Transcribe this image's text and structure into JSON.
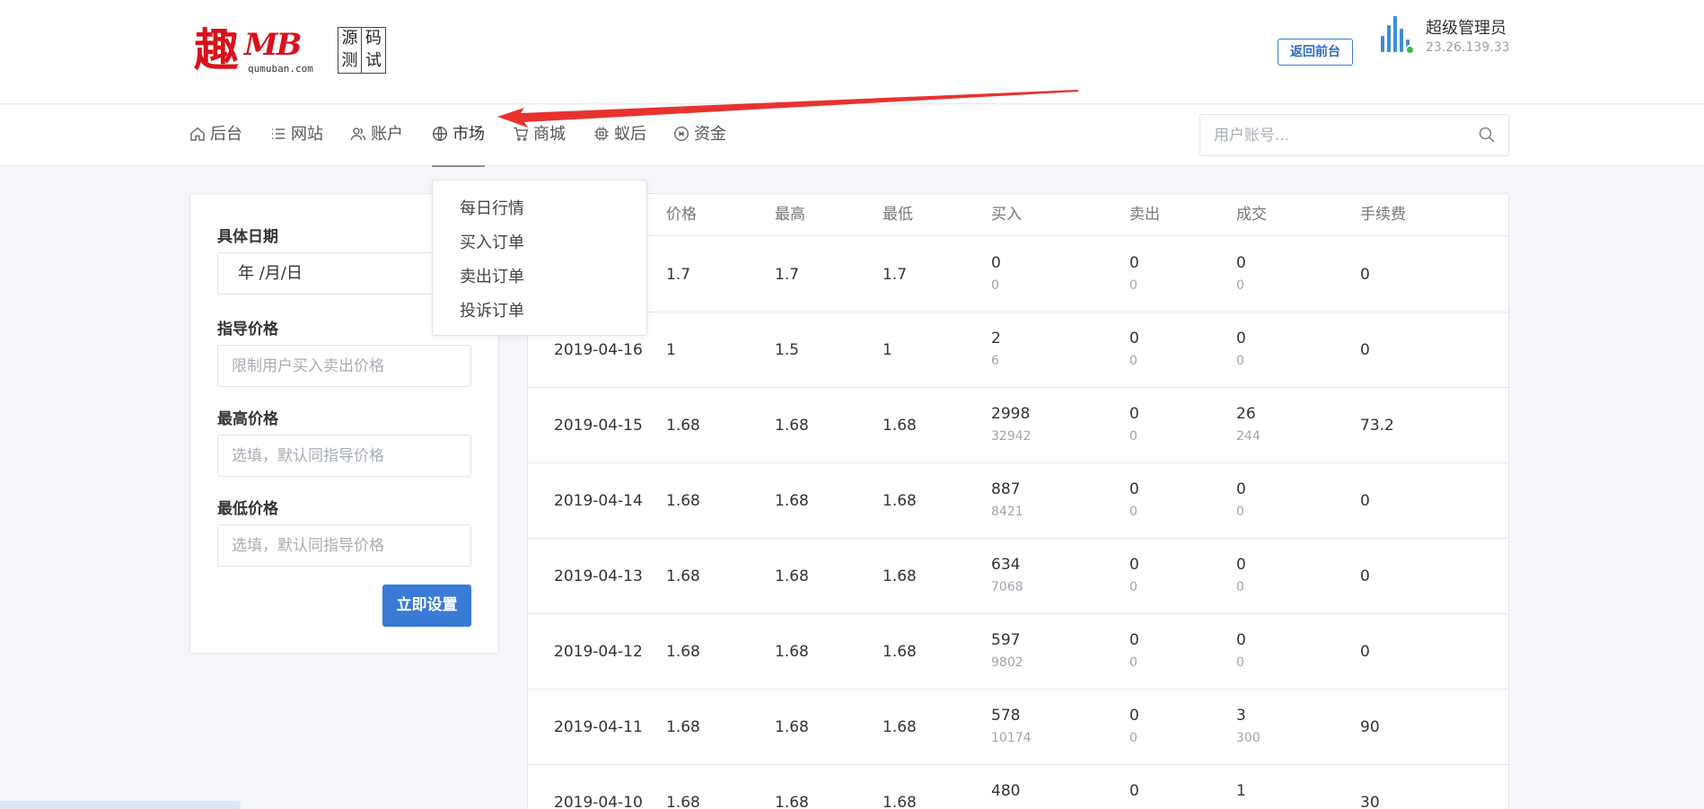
{
  "logo": {
    "char": "趣",
    "mb": "MB",
    "site": "qumuban.com",
    "stamp": [
      "源",
      "码",
      "测",
      "试"
    ]
  },
  "header": {
    "back_button": "返回前台",
    "admin_name": "超级管理员",
    "admin_ip": "23.26.139.33"
  },
  "nav": {
    "items": [
      {
        "label": "后台",
        "icon": "home-icon"
      },
      {
        "label": "网站",
        "icon": "list-icon"
      },
      {
        "label": "账户",
        "icon": "users-icon"
      },
      {
        "label": "市场",
        "icon": "globe-icon",
        "active": true
      },
      {
        "label": "商城",
        "icon": "cart-icon"
      },
      {
        "label": "蚁后",
        "icon": "chip-icon"
      },
      {
        "label": "资金",
        "icon": "coin-icon"
      }
    ],
    "search_placeholder": "用户账号..."
  },
  "dropdown": {
    "items": [
      "每日行情",
      "买入订单",
      "卖出订单",
      "投诉订单"
    ]
  },
  "form": {
    "date_label": "具体日期",
    "date_value": "年 /月/日",
    "guide_label": "指导价格",
    "guide_placeholder": "限制用户买入卖出价格",
    "max_label": "最高价格",
    "max_placeholder": "选填，默认同指导价格",
    "min_label": "最低价格",
    "min_placeholder": "选填，默认同指导价格",
    "submit": "立即设置"
  },
  "table": {
    "headers": [
      "价格",
      "最高",
      "最低",
      "买入",
      "卖出",
      "成交",
      "手续费"
    ],
    "rows": [
      {
        "date": "",
        "price": "1.7",
        "high": "1.7",
        "low": "1.7",
        "buy": "0",
        "buy_sub": "0",
        "sell": "0",
        "sell_sub": "0",
        "deal": "0",
        "deal_sub": "0",
        "fee": "0"
      },
      {
        "date": "2019-04-16",
        "price": "1",
        "high": "1.5",
        "low": "1",
        "buy": "2",
        "buy_sub": "6",
        "sell": "0",
        "sell_sub": "0",
        "deal": "0",
        "deal_sub": "0",
        "fee": "0"
      },
      {
        "date": "2019-04-15",
        "price": "1.68",
        "high": "1.68",
        "low": "1.68",
        "buy": "2998",
        "buy_sub": "32942",
        "sell": "0",
        "sell_sub": "0",
        "deal": "26",
        "deal_sub": "244",
        "fee": "73.2"
      },
      {
        "date": "2019-04-14",
        "price": "1.68",
        "high": "1.68",
        "low": "1.68",
        "buy": "887",
        "buy_sub": "8421",
        "sell": "0",
        "sell_sub": "0",
        "deal": "0",
        "deal_sub": "0",
        "fee": "0"
      },
      {
        "date": "2019-04-13",
        "price": "1.68",
        "high": "1.68",
        "low": "1.68",
        "buy": "634",
        "buy_sub": "7068",
        "sell": "0",
        "sell_sub": "0",
        "deal": "0",
        "deal_sub": "0",
        "fee": "0"
      },
      {
        "date": "2019-04-12",
        "price": "1.68",
        "high": "1.68",
        "low": "1.68",
        "buy": "597",
        "buy_sub": "9802",
        "sell": "0",
        "sell_sub": "0",
        "deal": "0",
        "deal_sub": "0",
        "fee": "0"
      },
      {
        "date": "2019-04-11",
        "price": "1.68",
        "high": "1.68",
        "low": "1.68",
        "buy": "578",
        "buy_sub": "10174",
        "sell": "0",
        "sell_sub": "0",
        "deal": "3",
        "deal_sub": "300",
        "fee": "90"
      },
      {
        "date": "2019-04-10",
        "price": "1.68",
        "high": "1.68",
        "low": "1.68",
        "buy": "480",
        "buy_sub": "",
        "sell": "0",
        "sell_sub": "",
        "deal": "1",
        "deal_sub": "",
        "fee": "30"
      }
    ]
  },
  "colors": {
    "accent": "#3a7bd5",
    "brand_red": "#d9111a",
    "online": "#2fbb4f",
    "annotation_arrow": "#e8322f"
  }
}
